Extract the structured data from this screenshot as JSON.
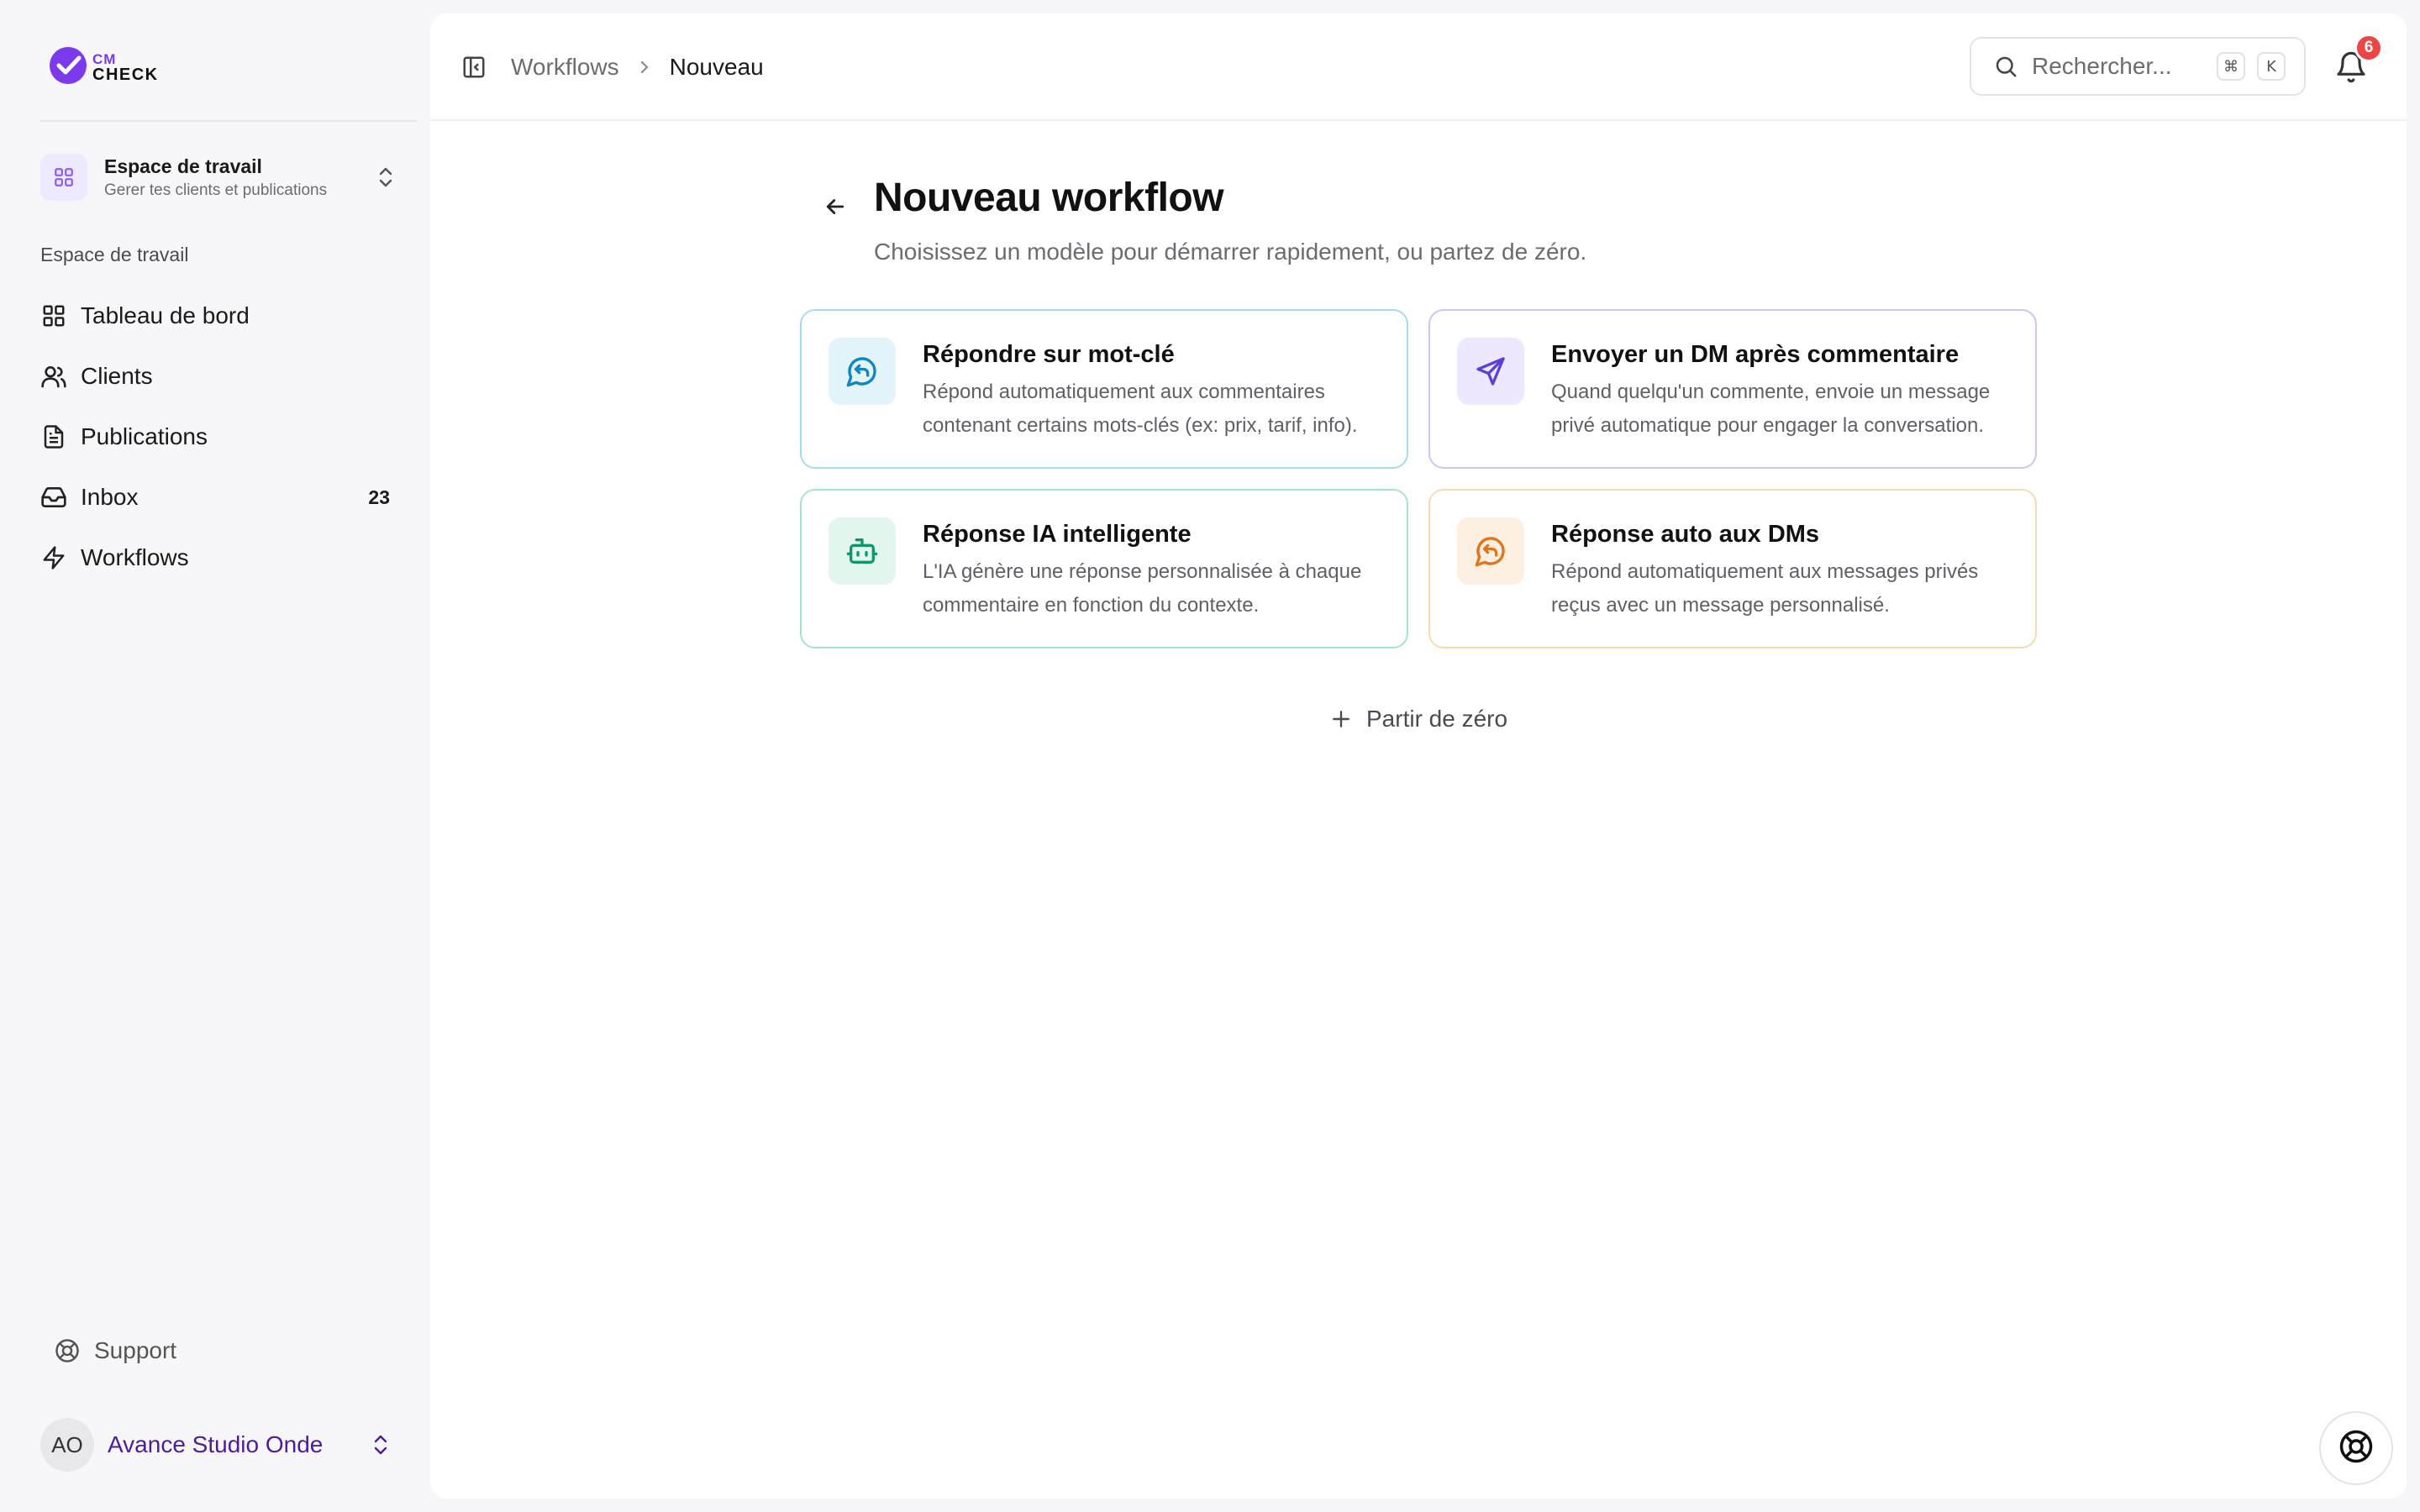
{
  "app": {
    "logo_line1": "CM",
    "logo_line2": "CHECK"
  },
  "workspace": {
    "title": "Espace de travail",
    "subtitle": "Gerer tes clients et publications"
  },
  "sidebar": {
    "section_label": "Espace de travail",
    "items": [
      {
        "label": "Tableau de bord",
        "icon": "grid-icon"
      },
      {
        "label": "Clients",
        "icon": "users-icon"
      },
      {
        "label": "Publications",
        "icon": "file-text-icon"
      },
      {
        "label": "Inbox",
        "icon": "inbox-icon",
        "count": "23"
      },
      {
        "label": "Workflows",
        "icon": "zap-icon"
      }
    ],
    "support_label": "Support"
  },
  "user": {
    "initials": "AO",
    "name": "Avance Studio Onde"
  },
  "breadcrumb": {
    "parent": "Workflows",
    "current": "Nouveau"
  },
  "search": {
    "placeholder": "Rechercher...",
    "shortcut_mod": "⌘",
    "shortcut_key": "K"
  },
  "notifications": {
    "count": "6"
  },
  "page": {
    "title": "Nouveau workflow",
    "subtitle": "Choisissez un modèle pour démarrer rapidement, ou partez de zéro."
  },
  "templates": [
    {
      "title": "Répondre sur mot-clé",
      "desc_line1": "Répond automatiquement aux commentaires",
      "desc_line2": "contenant certains mots-clés (ex: prix, tarif, info).",
      "icon": "message-reply-icon",
      "color": "#0e86c4"
    },
    {
      "title": "Envoyer un DM après commentaire",
      "desc_line1": "Quand quelqu'un commente, envoie un message",
      "desc_line2": "privé automatique pour engager la conversation.",
      "icon": "send-icon",
      "color": "#5b3fd6"
    },
    {
      "title": "Réponse IA intelligente",
      "desc_line1": "L'IA génère une réponse personnalisée à chaque",
      "desc_line2": "commentaire en fonction du contexte.",
      "icon": "bot-icon",
      "color": "#10966a"
    },
    {
      "title": "Réponse auto aux DMs",
      "desc_line1": "Répond automatiquement aux messages privés",
      "desc_line2": "reçus avec un message personnalisé.",
      "icon": "message-reply-icon",
      "color": "#e0751c"
    }
  ],
  "scratch_label": "Partir de zéro"
}
